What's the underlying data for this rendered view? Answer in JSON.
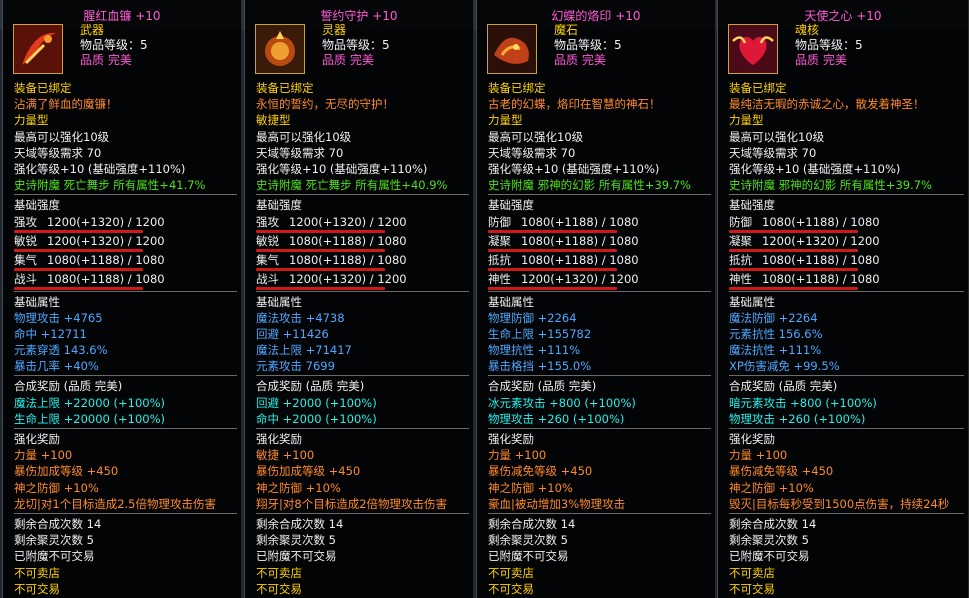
{
  "colors": {
    "title": "#ff5ad5",
    "gold": "#ffd200",
    "orange": "#ff8a2a",
    "green": "#4de01c",
    "blue": "#4fa8ff",
    "cyan": "#25f0ea"
  },
  "panels": [
    {
      "name": "腥红血镰 +10",
      "icon": "red-scythe-icon",
      "category": "武器",
      "level": "物品等级：5",
      "quality": "品质 完美",
      "bound": "装备已绑定",
      "flavor": "沾满了鲜血的魔镰！",
      "type": "力量型",
      "req1": "最高可以强化10级",
      "req2": "天域等级需求 70",
      "enh": "强化等级+10 (基础强度+110%)",
      "enchant": "史诗附魔 死亡舞步 所有属性+41.7%",
      "base_title": "基础强度",
      "stats": [
        {
          "label": "强攻",
          "value": "1200(+1320) / 1200",
          "fill": 1.0
        },
        {
          "label": "敏锐",
          "value": "1200(+1320) / 1200",
          "fill": 1.0
        },
        {
          "label": "集气",
          "value": "1080(+1188) / 1080",
          "fill": 1.0
        },
        {
          "label": "战斗",
          "value": "1080(+1188) / 1080",
          "fill": 1.0
        }
      ],
      "attr_title": "基础属性",
      "attrs": [
        "物理攻击 +4765",
        "命中 +12711",
        "元素穿透 143.6%",
        "暴击几率 +40%"
      ],
      "synth_title": "合成奖励 (品质 完美)",
      "synth": [
        "魔法上限 +22000 (+100%)",
        "生命上限 +20000 (+100%)"
      ],
      "enh_title": "强化奖励",
      "enh_bonus": [
        "力量 +100",
        "暴伤加成等级 +450",
        "神之防御 +10%"
      ],
      "special": "龙切|对1个目标造成2.5倍物理攻击伤害",
      "remain1": "剩余合成次数 14",
      "remain2": "剩余聚灵次数 5",
      "enchanted": "已附魔不可交易",
      "no_sell": "不可卖店",
      "no_trade": "不可交易"
    },
    {
      "name": "誓约守护 +10",
      "icon": "golden-amulet-icon",
      "category": "灵器",
      "level": "物品等级：5",
      "quality": "品质 完美",
      "bound": "装备已绑定",
      "flavor": "永恒的誓约，无尽的守护！",
      "type": "敏捷型",
      "req1": "最高可以强化10级",
      "req2": "天域等级需求 70",
      "enh": "强化等级+10 (基础强度+110%)",
      "enchant": "史诗附魔 死亡舞步 所有属性+40.9%",
      "base_title": "基础强度",
      "stats": [
        {
          "label": "强攻",
          "value": "1200(+1320) / 1200",
          "fill": 1.0
        },
        {
          "label": "敏锐",
          "value": "1080(+1188) / 1080",
          "fill": 1.0
        },
        {
          "label": "集气",
          "value": "1080(+1188) / 1080",
          "fill": 1.0
        },
        {
          "label": "战斗",
          "value": "1200(+1320) / 1200",
          "fill": 1.0
        }
      ],
      "attr_title": "基础属性",
      "attrs": [
        "魔法攻击 +4738",
        "回避 +11426",
        "魔法上限 +71417",
        "元素攻击 7699"
      ],
      "synth_title": "合成奖励 (品质 完美)",
      "synth": [
        "回避 +2000 (+100%)",
        "命中 +2000 (+100%)"
      ],
      "enh_title": "强化奖励",
      "enh_bonus": [
        "敏捷 +100",
        "暴伤加成等级 +450",
        "神之防御 +10%"
      ],
      "special": "翔牙|对8个目标造成2倍物理攻击伤害",
      "remain1": "剩余合成次数 14",
      "remain2": "剩余聚灵次数 5",
      "enchanted": "已附魔不可交易",
      "no_sell": "不可卖店",
      "no_trade": "不可交易"
    },
    {
      "name": "幻蝶的烙印 +10",
      "icon": "fire-stone-icon",
      "category": "魔石",
      "level": "物品等级：5",
      "quality": "品质 完美",
      "bound": "装备已绑定",
      "flavor": "古老的幻蝶，烙印在智慧的神石！",
      "type": "力量型",
      "req1": "最高可以强化10级",
      "req2": "天域等级需求 70",
      "enh": "强化等级+10 (基础强度+110%)",
      "enchant": "史诗附魔 邪神的幻影 所有属性+39.7%",
      "base_title": "基础强度",
      "stats": [
        {
          "label": "防御",
          "value": "1080(+1188) / 1080",
          "fill": 1.0
        },
        {
          "label": "凝聚",
          "value": "1080(+1188) / 1080",
          "fill": 1.0
        },
        {
          "label": "抵抗",
          "value": "1080(+1188) / 1080",
          "fill": 1.0
        },
        {
          "label": "神性",
          "value": "1200(+1320) / 1200",
          "fill": 1.0
        }
      ],
      "attr_title": "基础属性",
      "attrs": [
        "物理防御 +2264",
        "生命上限 +155782",
        "物理抗性 +111%",
        "暴击格挡 +155.0%"
      ],
      "synth_title": "合成奖励 (品质 完美)",
      "synth": [
        "冰元素攻击 +800 (+100%)",
        "物理攻击 +260 (+100%)"
      ],
      "enh_title": "强化奖励",
      "enh_bonus": [
        "力量 +100",
        "暴伤减免等级 +450",
        "神之防御 +10%"
      ],
      "special": "豪血|被动增加3%物理攻击",
      "remain1": "剩余合成次数 14",
      "remain2": "剩余聚灵次数 5",
      "enchanted": "已附魔不可交易",
      "no_sell": "不可卖店",
      "no_trade": "不可交易"
    },
    {
      "name": "天使之心 +10",
      "icon": "angel-heart-icon",
      "category": "魂核",
      "level": "物品等级：5",
      "quality": "品质 完美",
      "bound": "装备已绑定",
      "flavor": "最纯洁无暇的赤诚之心，散发着神圣！",
      "type": "力量型",
      "req1": "最高可以强化10级",
      "req2": "天域等级需求 70",
      "enh": "强化等级+10 (基础强度+110%)",
      "enchant": "史诗附魔 邪神的幻影 所有属性+39.7%",
      "base_title": "基础强度",
      "stats": [
        {
          "label": "防御",
          "value": "1080(+1188) / 1080",
          "fill": 1.0
        },
        {
          "label": "凝聚",
          "value": "1200(+1320) / 1200",
          "fill": 1.0
        },
        {
          "label": "抵抗",
          "value": "1080(+1188) / 1080",
          "fill": 1.0
        },
        {
          "label": "神性",
          "value": "1080(+1188) / 1080",
          "fill": 1.0
        }
      ],
      "attr_title": "基础属性",
      "attrs": [
        "魔法防御 +2264",
        "元素抗性 156.6%",
        "魔法抗性 +111%",
        "XP伤害减免 +99.5%"
      ],
      "synth_title": "合成奖励 (品质 完美)",
      "synth": [
        "暗元素攻击 +800 (+100%)",
        "物理攻击 +260 (+100%)"
      ],
      "enh_title": "强化奖励",
      "enh_bonus": [
        "力量 +100",
        "暴伤减免等级 +450",
        "神之防御 +10%"
      ],
      "special": "毁灭|目标每秒受到1500点伤害，持续24秒",
      "remain1": "剩余合成次数 14",
      "remain2": "剩余聚灵次数 5",
      "enchanted": "已附魔不可交易",
      "no_sell": "不可卖店",
      "no_trade": "不可交易"
    }
  ]
}
